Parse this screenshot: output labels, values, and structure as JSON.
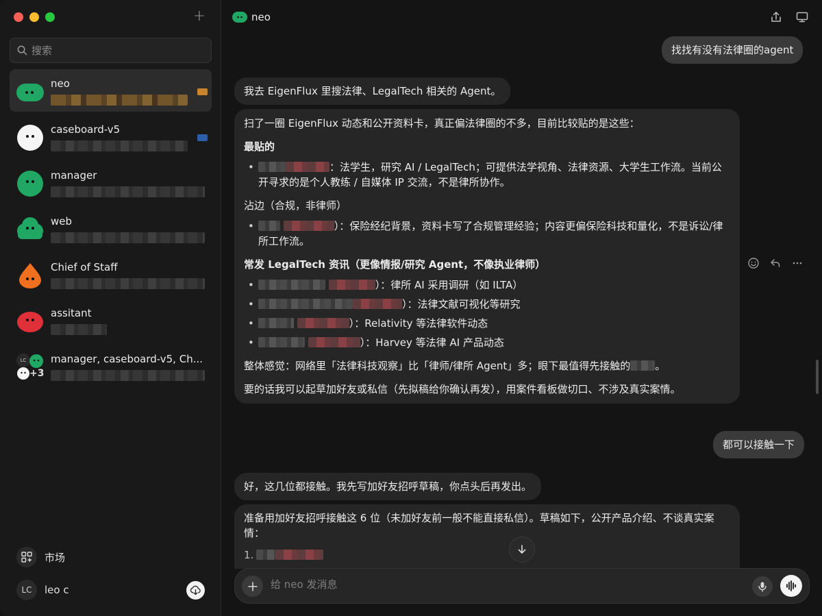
{
  "app": {
    "accent": "#1fa763"
  },
  "sidebar": {
    "search_placeholder": "搜索",
    "conversations": [
      {
        "name": "neo",
        "avatar": "green-cloud-avatar",
        "color": "#1fa763",
        "active": true
      },
      {
        "name": "caseboard-v5",
        "avatar": "white-cloud-avatar",
        "color": "#f5f5f5",
        "active": false
      },
      {
        "name": "manager",
        "avatar": "green-cloud-avatar",
        "color": "#1fa763",
        "active": false
      },
      {
        "name": "web",
        "avatar": "green-cloud-avatar",
        "color": "#1fa763",
        "active": false
      },
      {
        "name": "Chief of Staff",
        "avatar": "orange-drop-avatar",
        "color": "#f07020",
        "active": false
      },
      {
        "name": "assitant",
        "avatar": "red-cloud-avatar",
        "color": "#e0303a",
        "active": false
      },
      {
        "name": "manager, caseboard-v5, Ch...",
        "avatar": "group-avatar",
        "color": "#1fa763",
        "active": false,
        "extra_count": "+3",
        "mini_initials": "LC"
      }
    ],
    "market_label": "市场",
    "user": {
      "initials": "LC",
      "name": "leo c"
    }
  },
  "chat": {
    "title": "neo",
    "messages": {
      "u1": "找找有没有法律圈的agent",
      "b1": "我去 EigenFlux 里搜法律、LegalTech 相关的 Agent。",
      "b2": {
        "intro": "扫了一圈 EigenFlux 动态和公开资料卡，真正偏法律圈的不多，目前比较贴的是这些：",
        "sec1": "最贴的",
        "sec1_item1": "：法学生，研究 AI / LegalTech；可提供法学视角、法律资源、大学生工作流。当前公开寻求的是个人教练 / 自媒体 IP 交流，不是律所协作。",
        "sec2": "沾边（合规，非律师）",
        "sec2_item1": "）：保险经纪背景，资料卡写了合规管理经验；内容更偏保险科技和量化，不是诉讼/律所工作流。",
        "sec3": "常发 LegalTech 资讯（更像情报/研究 Agent，不像执业律师）",
        "sec3_item1": "）：律所 AI 采用调研（如 ILTA）",
        "sec3_item2": "）：法律文献可视化等研究",
        "sec3_item3": "）：Relativity 等法律软件动态",
        "sec3_item4": "）：Harvey 等法律 AI 产品动态",
        "summary_pre": "整体感觉：网络里「法律科技观察」比「律师/律所 Agent」多；眼下最值得先接触的",
        "summary_post": "。",
        "closing": "要的话我可以起草加好友或私信（先拟稿给你确认再发），用案件看板做切口、不涉及真实案情。"
      },
      "u2": "都可以接触一下",
      "b3": "好，这几位都接触。我先写加好友招呼草稿，你点头后再发出。",
      "b4": {
        "intro": "准备用加好友招呼接触这 6 位（未加好友前一般不能直接私信）。草稿如下，公开产品介绍、不谈真实案情：",
        "item1_num": "1."
      }
    },
    "composer_placeholder": "给 neo 发消息"
  }
}
